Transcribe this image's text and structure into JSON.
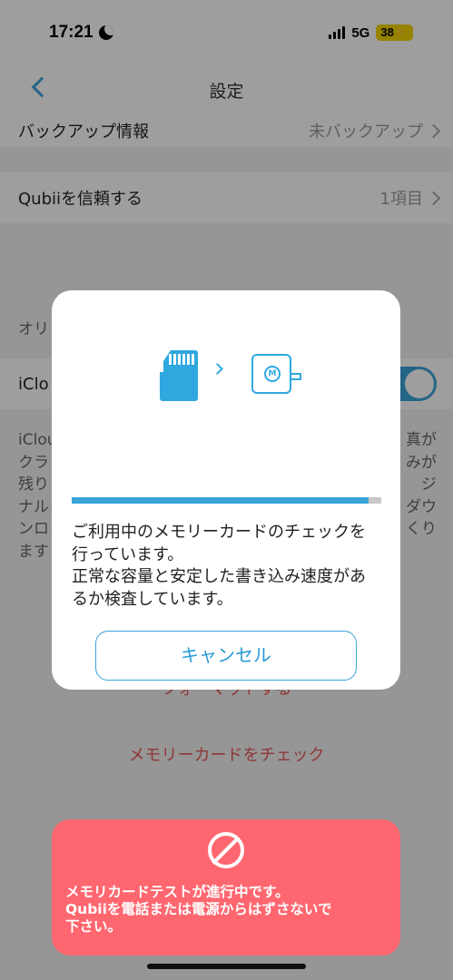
{
  "status_bar": {
    "time": "17:21",
    "network": "5G",
    "battery": "38"
  },
  "nav": {
    "title": "設定"
  },
  "settings": {
    "backup_info": {
      "label": "バックアップ情報",
      "value": "未バックアップ"
    },
    "trust": {
      "label": "Qubiiを信頼する",
      "value": "1項目"
    },
    "section_partial": "オリ",
    "icloud_partial": "iClo",
    "desc_left_lines": [
      "iClou",
      "クラ",
      "残り",
      "ナル",
      "ンロ",
      "ます"
    ],
    "desc_right_lines": [
      "真が",
      "みが",
      "ジ",
      "ダウ",
      "くり"
    ],
    "format_partial": "フォーマットする",
    "check_memory_card": "メモリーカードをチェック"
  },
  "modal": {
    "progress": 0.96,
    "message_lines": [
      "ご利用中のメモリーカードのチェックを",
      "行っています。",
      "正常な容量と安定した書き込み速度があ",
      "るか検査しています。"
    ],
    "cancel_label": "キャンセル"
  },
  "toast": {
    "lines": [
      "メモリカードテストが進行中です。",
      "Qubiiを電話または電源からはずさないで",
      "下さい。"
    ]
  },
  "colors": {
    "accent": "#3aa3d8",
    "toast_bg": "#ff6770",
    "link_red": "#e85a5a"
  }
}
